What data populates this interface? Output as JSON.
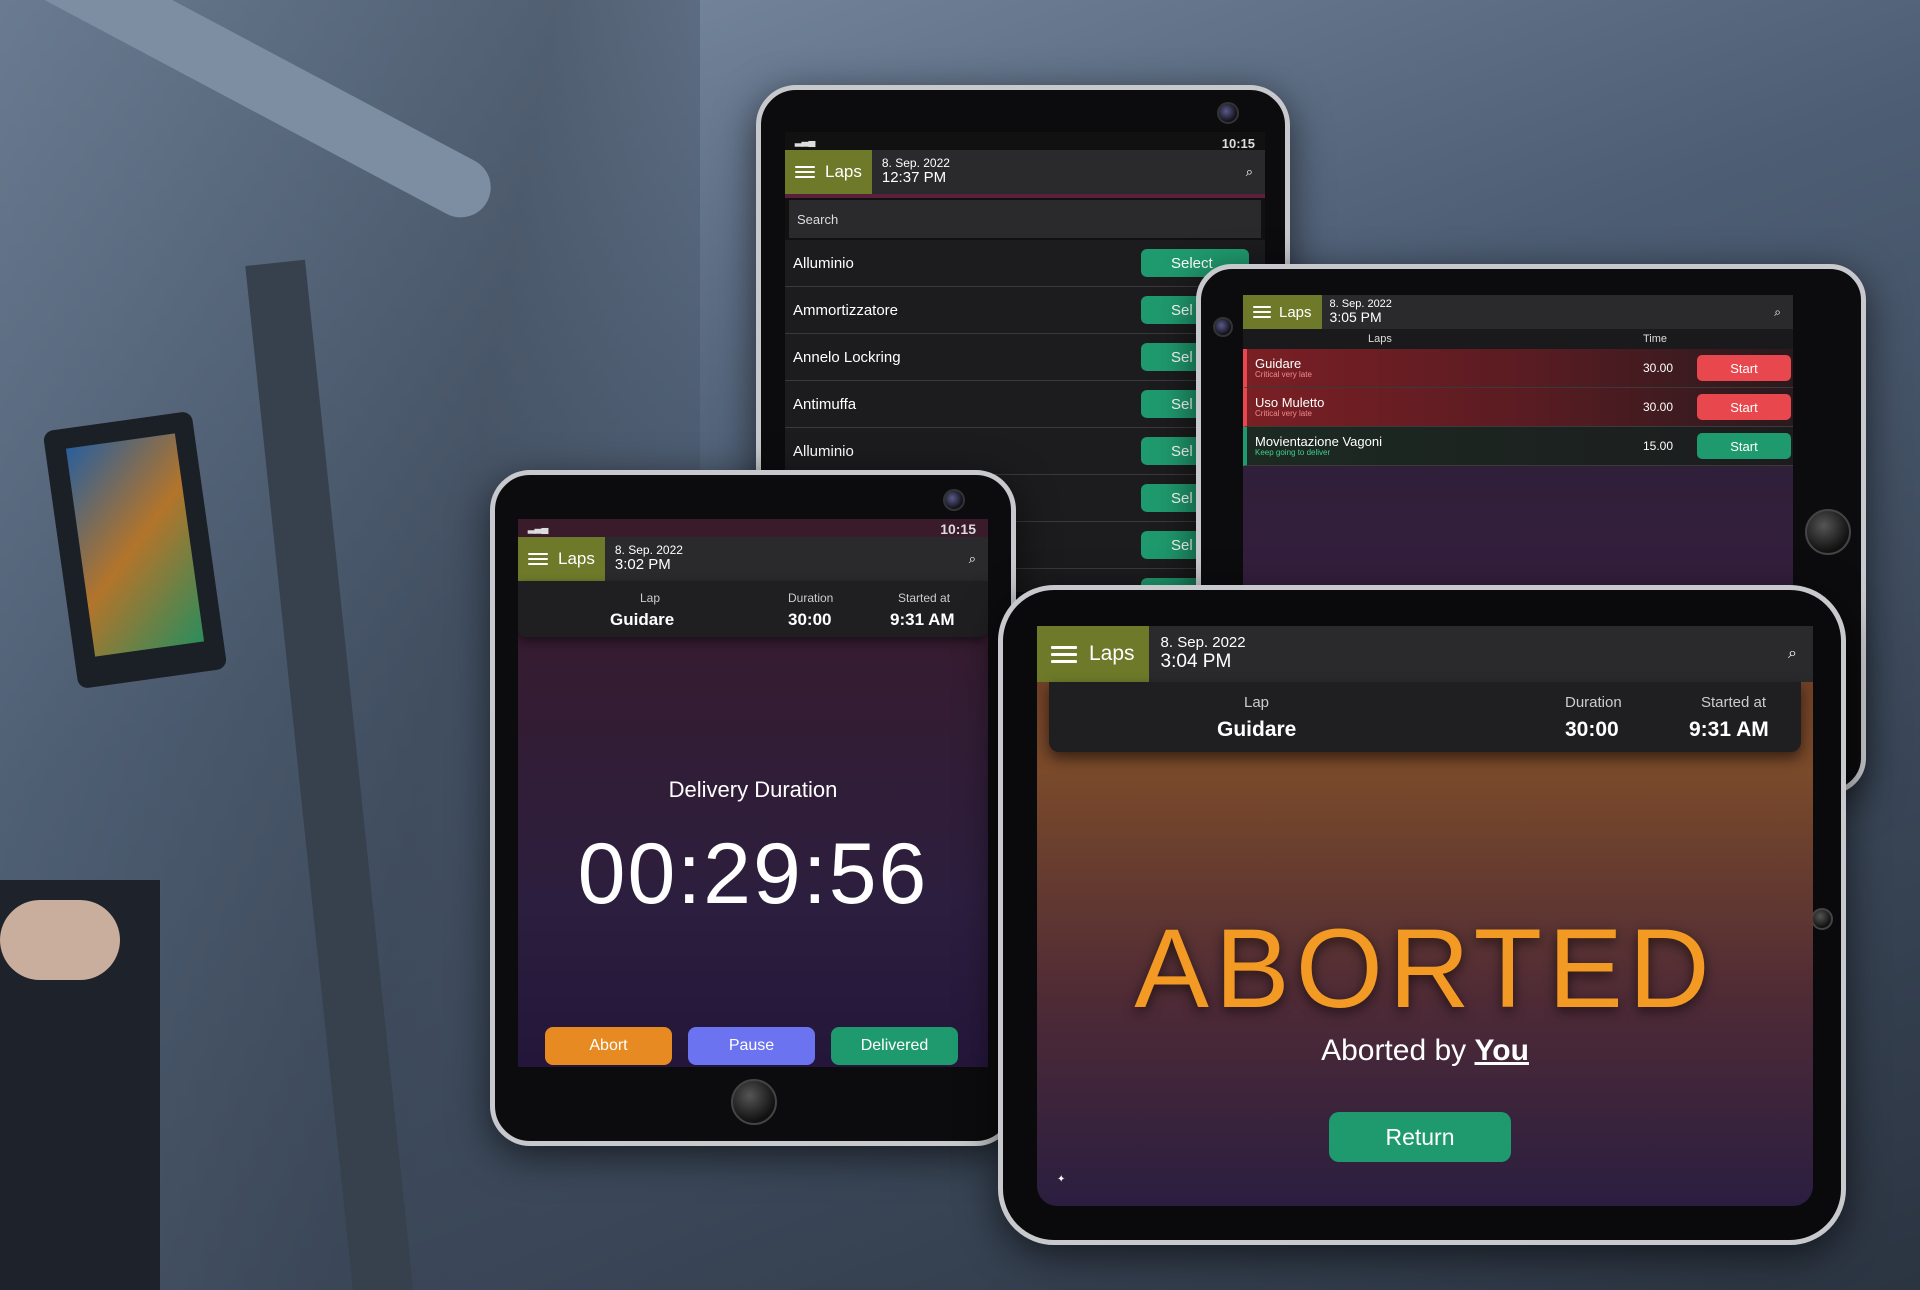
{
  "colors": {
    "accent_olive": "#6e7a2a",
    "green": "#1f9a6e",
    "red": "#e8474d",
    "orange": "#e88a22",
    "blue": "#6c73f0"
  },
  "tablet_list": {
    "status_time": "10:15",
    "menu_label": "Laps",
    "date": "8. Sep. 2022",
    "time": "12:37 PM",
    "search_placeholder": "Search",
    "items": [
      {
        "name": "Alluminio",
        "button": "Select"
      },
      {
        "name": "Ammortizzatore",
        "button": "Sel"
      },
      {
        "name": "Annelo Lockring",
        "button": "Sel"
      },
      {
        "name": "Antimuffa",
        "button": "Sel"
      },
      {
        "name": "Alluminio",
        "button": "Sel"
      },
      {
        "name": "",
        "button": "Sel"
      },
      {
        "name": "",
        "button": "Sel"
      },
      {
        "name": "",
        "button": "Sel"
      }
    ]
  },
  "tablet_laps": {
    "menu_label": "Laps",
    "date": "8. Sep. 2022",
    "time": "3:05 PM",
    "col_laps": "Laps",
    "col_time": "Time",
    "rows": [
      {
        "name": "Guidare",
        "sub": "Critical very late",
        "time": "30.00",
        "button": "Start",
        "status": "late"
      },
      {
        "name": "Uso Muletto",
        "sub": "Critical very late",
        "time": "30.00",
        "button": "Start",
        "status": "late"
      },
      {
        "name": "Movientazione Vagoni",
        "sub": "Keep going to deliver",
        "time": "15.00",
        "button": "Start",
        "status": "ok"
      }
    ]
  },
  "tablet_timer": {
    "status_time": "10:15",
    "menu_label": "Laps",
    "date": "8. Sep. 2022",
    "time": "3:02 PM",
    "lap_label": "Lap",
    "lap_value": "Guidare",
    "duration_label": "Duration",
    "duration_value": "30:00",
    "started_label": "Started at",
    "started_value": "9:31 AM",
    "heading": "Delivery Duration",
    "timer": "00:29:56",
    "abort": "Abort",
    "pause": "Pause",
    "delivered": "Delivered"
  },
  "tablet_aborted": {
    "menu_label": "Laps",
    "date": "8. Sep. 2022",
    "time": "3:04 PM",
    "lap_label": "Lap",
    "lap_value": "Guidare",
    "duration_label": "Duration",
    "duration_value": "30:00",
    "started_label": "Started at",
    "started_value": "9:31 AM",
    "title": "ABORTED",
    "by_prefix": "Aborted by",
    "by_user": "You",
    "return": "Return"
  }
}
